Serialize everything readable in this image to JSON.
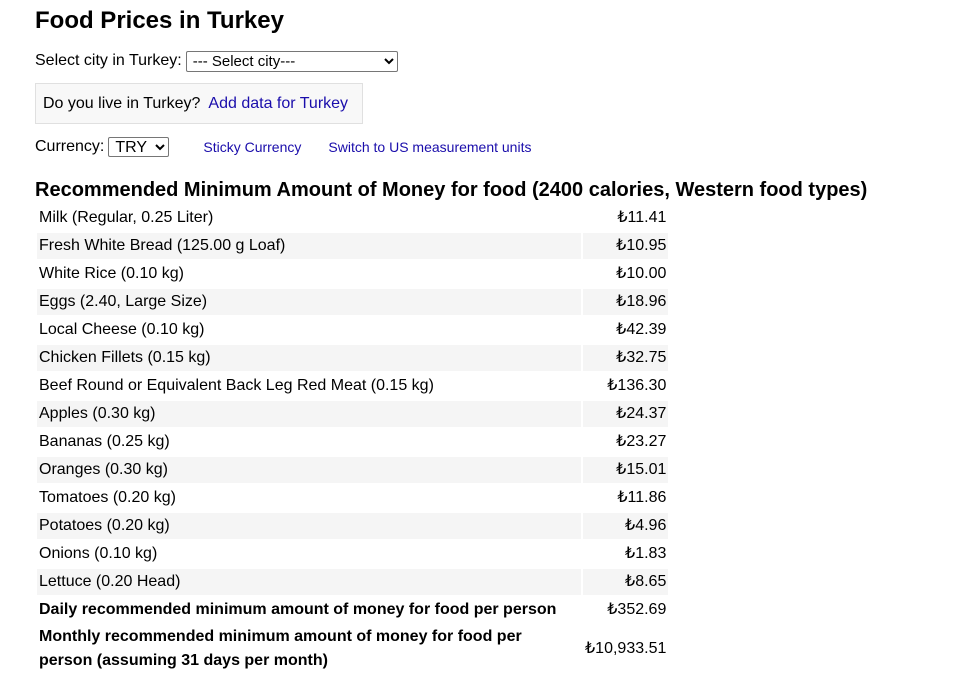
{
  "page": {
    "title": "Food Prices in Turkey"
  },
  "city_select": {
    "label": "Select city in Turkey:",
    "selected": "--- Select city---"
  },
  "live_box": {
    "question": "Do you live in Turkey?",
    "link": "Add data for Turkey"
  },
  "currency": {
    "label": "Currency:",
    "selected": "TRY",
    "sticky_link": "Sticky Currency",
    "units_link": "Switch to US measurement units"
  },
  "section": {
    "title": "Recommended Minimum Amount of Money for food (2400 calories, Western food types)"
  },
  "items": [
    {
      "name": "Milk (Regular, 0.25 Liter)",
      "price": "₺11.41"
    },
    {
      "name": "Fresh White Bread (125.00 g Loaf)",
      "price": "₺10.95"
    },
    {
      "name": "White Rice (0.10 kg)",
      "price": "₺10.00"
    },
    {
      "name": "Eggs (2.40, Large Size)",
      "price": "₺18.96"
    },
    {
      "name": "Local Cheese (0.10 kg)",
      "price": "₺42.39"
    },
    {
      "name": "Chicken Fillets (0.15 kg)",
      "price": "₺32.75"
    },
    {
      "name": "Beef Round or Equivalent Back Leg Red Meat (0.15 kg)",
      "price": "₺136.30"
    },
    {
      "name": "Apples (0.30 kg)",
      "price": "₺24.37"
    },
    {
      "name": "Bananas (0.25 kg)",
      "price": "₺23.27"
    },
    {
      "name": "Oranges (0.30 kg)",
      "price": "₺15.01"
    },
    {
      "name": "Tomatoes (0.20 kg)",
      "price": "₺11.86"
    },
    {
      "name": "Potatoes (0.20 kg)",
      "price": "₺4.96"
    },
    {
      "name": "Onions (0.10 kg)",
      "price": "₺1.83"
    },
    {
      "name": "Lettuce (0.20 Head)",
      "price": "₺8.65"
    }
  ],
  "totals": {
    "daily_label": "Daily recommended minimum amount of money for food per person",
    "daily_value": "₺352.69",
    "monthly_label": "Monthly recommended minimum amount of money for food per person (assuming 31 days per month)",
    "monthly_value": "₺10,933.51"
  }
}
